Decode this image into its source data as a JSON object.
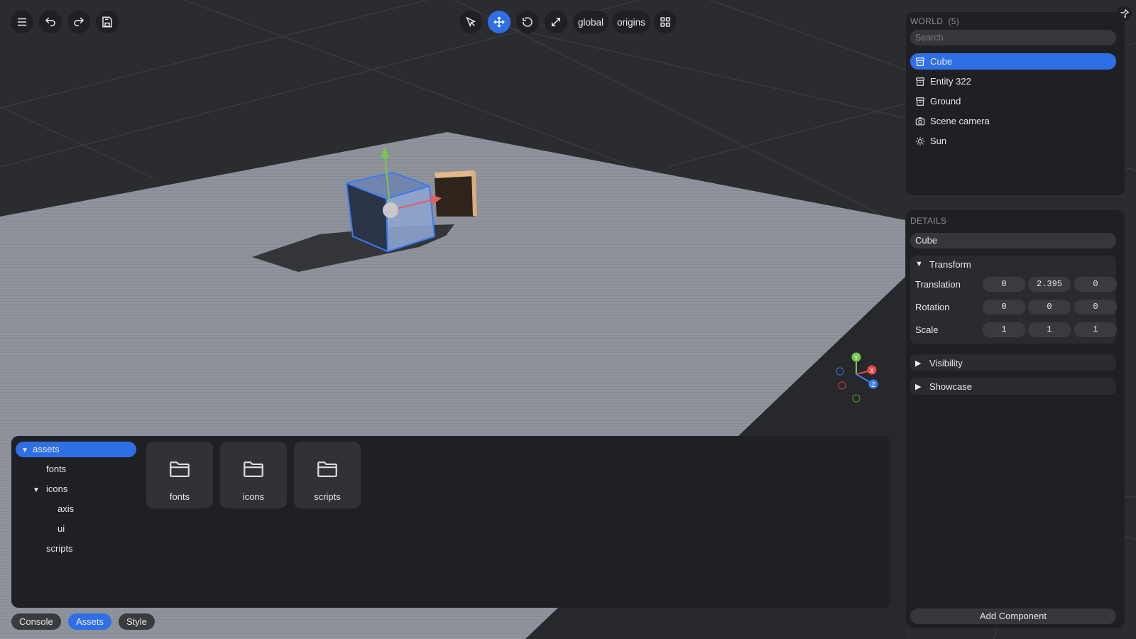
{
  "toolbar": {
    "left": [
      "menu-icon",
      "undo-icon",
      "redo-icon",
      "save-icon"
    ],
    "center": {
      "space_label": "global",
      "pivot_label": "origins"
    }
  },
  "world": {
    "title": "WORLD",
    "count": "(5)",
    "search_placeholder": "Search",
    "items": [
      {
        "label": "Cube",
        "icon": "entity-icon",
        "selected": true
      },
      {
        "label": "Entity 322",
        "icon": "entity-icon",
        "selected": false
      },
      {
        "label": "Ground",
        "icon": "entity-icon",
        "selected": false
      },
      {
        "label": "Scene camera",
        "icon": "camera-icon",
        "selected": false
      },
      {
        "label": "Sun",
        "icon": "sun-icon",
        "selected": false
      }
    ]
  },
  "details": {
    "title": "DETAILS",
    "name": "Cube",
    "transform": {
      "label": "Transform",
      "translation": {
        "label": "Translation",
        "values": [
          "0",
          "2.395",
          "0"
        ]
      },
      "rotation": {
        "label": "Rotation",
        "values": [
          "0",
          "0",
          "0"
        ]
      },
      "scale": {
        "label": "Scale",
        "values": [
          "1",
          "1",
          "1"
        ]
      }
    },
    "visibility_label": "Visibility",
    "showcase_label": "Showcase",
    "add_component_label": "Add Component"
  },
  "gizmo_axes": {
    "x": "X",
    "y": "Y",
    "z": "Z"
  },
  "assets": {
    "tree": [
      {
        "label": "assets",
        "depth": 0,
        "expanded": true,
        "selected": true
      },
      {
        "label": "fonts",
        "depth": 1,
        "expanded": false,
        "selected": false
      },
      {
        "label": "icons",
        "depth": 1,
        "expanded": true,
        "selected": false
      },
      {
        "label": "axis",
        "depth": 2,
        "expanded": false,
        "selected": false
      },
      {
        "label": "ui",
        "depth": 2,
        "expanded": false,
        "selected": false
      },
      {
        "label": "scripts",
        "depth": 1,
        "expanded": false,
        "selected": false
      }
    ],
    "folders": [
      "fonts",
      "icons",
      "scripts"
    ]
  },
  "tabs": [
    {
      "label": "Console",
      "active": false
    },
    {
      "label": "Assets",
      "active": true
    },
    {
      "label": "Style",
      "active": false
    }
  ],
  "colors": {
    "accent": "#2f6fe6",
    "panel": "#1f2023",
    "axis_x": "#e5484d",
    "axis_y": "#7ac74f",
    "axis_z": "#3b82f6"
  }
}
